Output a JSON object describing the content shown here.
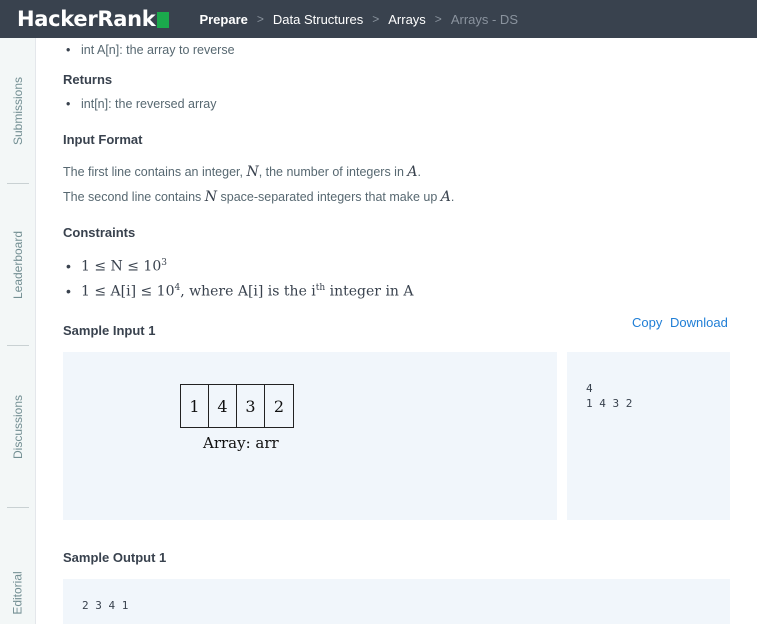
{
  "header": {
    "logo": "HackerRank",
    "breadcrumb": [
      "Prepare",
      "Data Structures",
      "Arrays",
      "Arrays - DS"
    ]
  },
  "sidebar": {
    "tabs": [
      "Submissions",
      "Leaderboard",
      "Discussions",
      "Editorial"
    ]
  },
  "problem": {
    "param_bullet": "int A[n]: the array to reverse",
    "returns_heading": "Returns",
    "returns_bullet": "int[n]: the reversed array",
    "input_format_heading": "Input Format",
    "input_line1_a": "The first line contains an integer, ",
    "input_line1_var": "N",
    "input_line1_b": ", the number of integers in ",
    "input_line1_var2": "A",
    "input_line1_c": ".",
    "input_line2_a": "The second line contains ",
    "input_line2_var": "N",
    "input_line2_b": " space-separated integers that make up ",
    "input_line2_var2": "A",
    "input_line2_c": ".",
    "constraints_heading": "Constraints",
    "constraint1": "1 ≤ N ≤ 10",
    "constraint1_exp": "3",
    "constraint2_a": "1 ≤ A[i] ≤ 10",
    "constraint2_exp": "4",
    "constraint2_b": ", where A[i] is the i",
    "constraint2_sup": "th",
    "constraint2_c": " integer in A"
  },
  "sample_input": {
    "heading": "Sample Input 1",
    "copy_label": "Copy",
    "download_label": "Download",
    "code": "4\n1 4 3 2",
    "diagram_cells": [
      "1",
      "4",
      "3",
      "2"
    ],
    "diagram_caption": "Array: arr"
  },
  "sample_output": {
    "heading": "Sample Output 1",
    "code": "2 3 4 1"
  }
}
